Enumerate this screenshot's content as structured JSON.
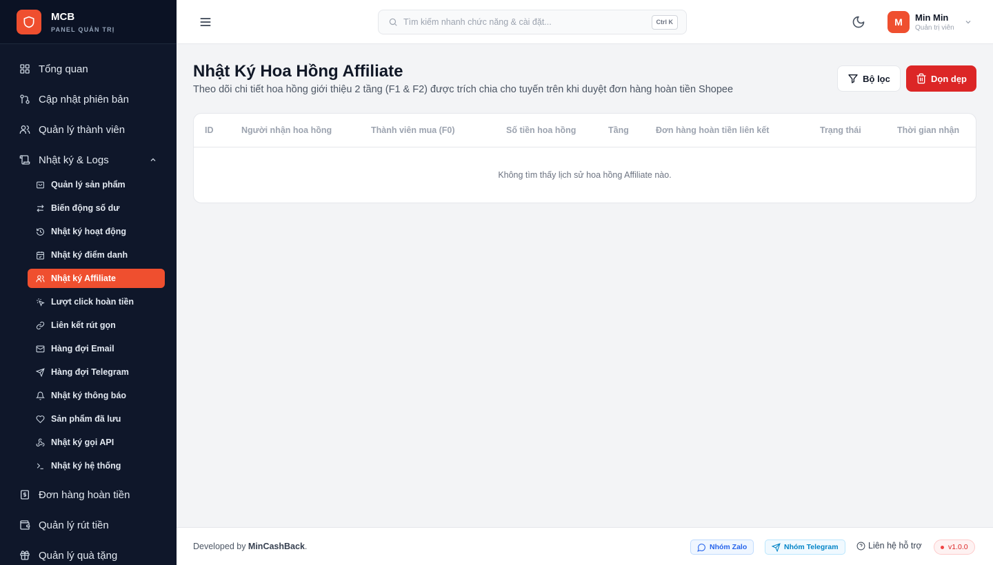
{
  "brand": {
    "name": "MCB",
    "subtitle": "PANEL QUẢN TRỊ"
  },
  "sidebar": {
    "items": [
      {
        "label": "Tổng quan",
        "icon": "grid-icon"
      },
      {
        "label": "Cập nhật phiên bản",
        "icon": "git-branch-icon"
      },
      {
        "label": "Quản lý thành viên",
        "icon": "users-icon"
      },
      {
        "label": "Nhật ký & Logs",
        "icon": "scroll-icon",
        "expanded": true
      }
    ],
    "sub_items": [
      {
        "label": "Quản lý sản phẩm",
        "icon": "package-icon"
      },
      {
        "label": "Biến động số dư",
        "icon": "arrows-exchange-icon"
      },
      {
        "label": "Nhật ký hoạt động",
        "icon": "history-icon"
      },
      {
        "label": "Nhật ký điểm danh",
        "icon": "calendar-check-icon"
      },
      {
        "label": "Nhật ký Affiliate",
        "icon": "users-icon",
        "active": true
      },
      {
        "label": "Lượt click hoàn tiền",
        "icon": "click-icon"
      },
      {
        "label": "Liên kết rút gọn",
        "icon": "link-icon"
      },
      {
        "label": "Hàng đợi Email",
        "icon": "mail-icon"
      },
      {
        "label": "Hàng đợi Telegram",
        "icon": "send-icon"
      },
      {
        "label": "Nhật ký thông báo",
        "icon": "bell-icon"
      },
      {
        "label": "Sản phẩm đã lưu",
        "icon": "heart-icon"
      },
      {
        "label": "Nhật ký gọi API",
        "icon": "webhook-icon"
      },
      {
        "label": "Nhật ký hệ thống",
        "icon": "terminal-icon"
      }
    ],
    "bottom_items": [
      {
        "label": "Đơn hàng hoàn tiền",
        "icon": "receipt-icon"
      },
      {
        "label": "Quản lý rút tiền",
        "icon": "wallet-icon"
      },
      {
        "label": "Quản lý quà tặng",
        "icon": "gift-icon"
      }
    ]
  },
  "header": {
    "search_placeholder": "Tìm kiếm nhanh chức năng & cài đặt...",
    "search_shortcut": "Ctrl K",
    "user_initial": "M",
    "user_name": "Min Min",
    "user_role": "Quản trị viên"
  },
  "page": {
    "title": "Nhật Ký Hoa Hồng Affiliate",
    "subtitle": "Theo dõi chi tiết hoa hồng giới thiệu 2 tầng (F1 & F2) được trích chia cho tuyến trên khi duyệt đơn hàng hoàn tiền Shopee",
    "filter_label": "Bộ lọc",
    "cleanup_label": "Dọn dẹp"
  },
  "table": {
    "columns": [
      "ID",
      "Người nhận hoa hồng",
      "Thành viên mua (F0)",
      "Số tiền hoa hồng",
      "Tầng",
      "Đơn hàng hoàn tiền liên kết",
      "Trạng thái",
      "Thời gian nhận"
    ],
    "rows": [],
    "empty_message": "Không tìm thấy lịch sử hoa hồng Affiliate nào."
  },
  "footer": {
    "dev_prefix": "Developed by ",
    "dev_name": "MinCashBack",
    "dev_suffix": ".",
    "zalo_label": "Nhóm Zalo",
    "telegram_label": "Nhóm Telegram",
    "support_label": "Liên hệ hỗ trợ",
    "version": "v1.0.0"
  },
  "colors": {
    "accent": "#ef4f2f",
    "danger": "#dc2626",
    "sidebar_bg": "#0f172a"
  }
}
